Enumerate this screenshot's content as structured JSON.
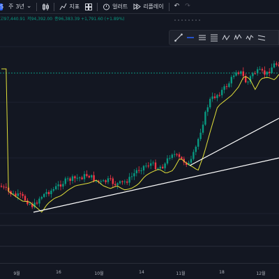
{
  "toolbar": {
    "symbol_initial": "S",
    "interval": "주",
    "range": "3년",
    "indicators_label": "지표",
    "alert_label": "얼러트",
    "replay_label": "리플레이"
  },
  "ohlc": {
    "high": "고97,440.91",
    "low": "저94,392.00",
    "close_change": "종96,383.39 +1,791.60 (+1.89%)"
  },
  "x_axis": {
    "ticks": [
      "9월",
      "16",
      "10월",
      "14",
      "11월",
      "18",
      "12월"
    ]
  },
  "colors": {
    "background": "#131722",
    "up": "#089981",
    "down": "#f23645",
    "moving_average": "#e2e03a",
    "trendline": "#ffffff",
    "price_line": "#089981"
  },
  "icons": {
    "dropdown": "chevron-down-icon",
    "candles": "candles-icon",
    "indicators": "indicators-icon",
    "alert": "alarm-icon",
    "replay": "replay-icon",
    "undo": "undo-icon",
    "redo": "redo-icon"
  }
}
